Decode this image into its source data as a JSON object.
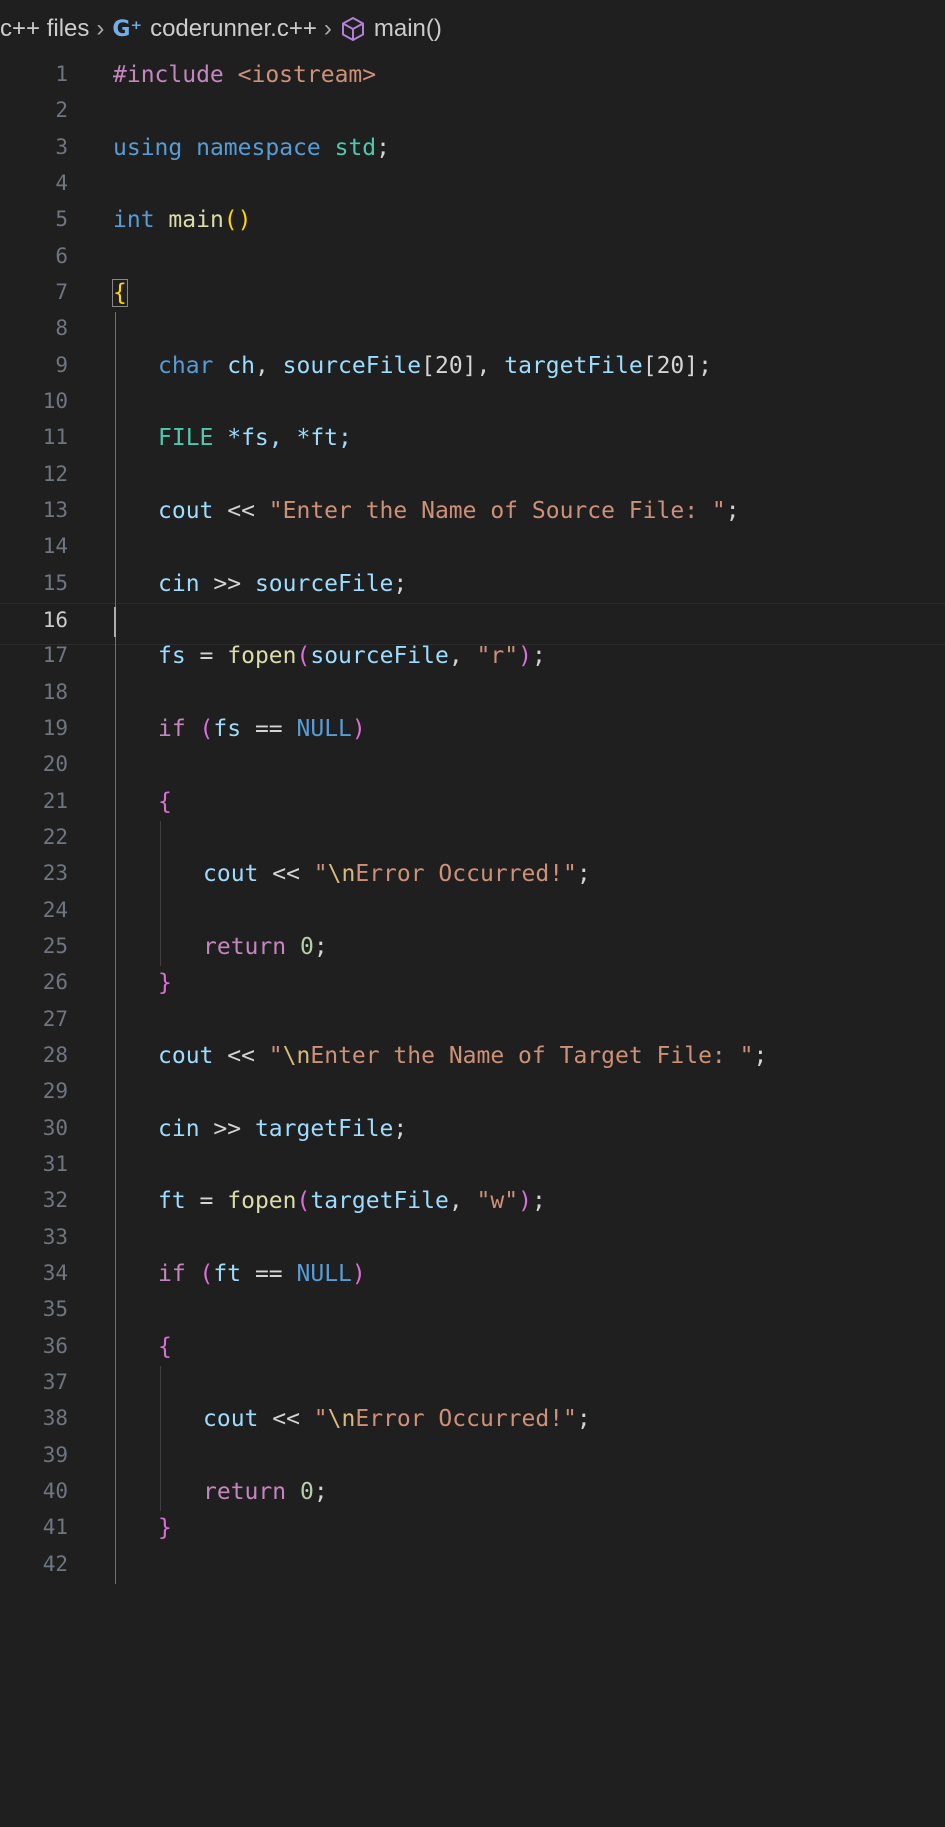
{
  "breadcrumb": {
    "folder": "c++ files",
    "sep": "›",
    "file": "coderunner.c++",
    "file_icon": "c++-file-icon",
    "symbol": "main()",
    "symbol_icon": "cube-method-icon"
  },
  "editor": {
    "active_line": 16,
    "line_numbers": [
      "1",
      "2",
      "3",
      "4",
      "5",
      "6",
      "7",
      "8",
      "9",
      "10",
      "11",
      "12",
      "13",
      "14",
      "15",
      "16",
      "17",
      "18",
      "19",
      "20",
      "21",
      "22",
      "23",
      "24",
      "25",
      "26",
      "27",
      "28",
      "29",
      "30",
      "31",
      "32",
      "33",
      "34",
      "35",
      "36",
      "37",
      "38",
      "39",
      "40",
      "41",
      "42"
    ],
    "code_text": {
      "l1_inc": "#include",
      "l1_path": "<iostream>",
      "l3_using": "using",
      "l3_namespace": "namespace",
      "l3_std": "std",
      "l3_semi": ";",
      "l5_int": "int",
      "l5_main": "main",
      "l5_parens": "()",
      "l7_brace": "{",
      "l9_char": "char",
      "l9_rest_a": "ch",
      "l9_comma1": ", ",
      "l9_src": "sourceFile",
      "l9_src_idx": "[20]",
      "l9_comma2": ", ",
      "l9_tgt": "targetFile",
      "l9_tgt_idx": "[20]",
      "l9_semi": ";",
      "l11_file": "FILE",
      "l11_rest": " *fs, *ft;",
      "l13_cout": "cout",
      "l13_op": " << ",
      "l13_str": "\"Enter the Name of Source File: \"",
      "l13_semi": ";",
      "l15_cin": "cin",
      "l15_op": " >> ",
      "l15_var": "sourceFile",
      "l15_semi": ";",
      "l17_fs": "fs",
      "l17_eq": " = ",
      "l17_fopen": "fopen",
      "l17_open": "(",
      "l17_arg": "sourceFile",
      "l17_comma": ", ",
      "l17_mode": "\"r\"",
      "l17_close": ")",
      "l17_semi": ";",
      "l19_if": "if",
      "l19_open": " (",
      "l19_fs": "fs",
      "l19_eq": " == ",
      "l19_null": "NULL",
      "l19_close": ")",
      "l21_brace": "{",
      "l23_cout": "cout",
      "l23_op": " << ",
      "l23_q1": "\"",
      "l23_esc": "\\n",
      "l23_str": "Error Occurred!\"",
      "l23_semi": ";",
      "l25_return": "return",
      "l25_zero": "0",
      "l25_semi": ";",
      "l26_brace": "}",
      "l28_cout": "cout",
      "l28_op": " << ",
      "l28_q1": "\"",
      "l28_esc": "\\n",
      "l28_str": "Enter the Name of Target File: \"",
      "l28_semi": ";",
      "l30_cin": "cin",
      "l30_op": " >> ",
      "l30_var": "targetFile",
      "l30_semi": ";",
      "l32_ft": "ft",
      "l32_eq": " = ",
      "l32_fopen": "fopen",
      "l32_open": "(",
      "l32_arg": "targetFile",
      "l32_comma": ", ",
      "l32_mode": "\"w\"",
      "l32_close": ")",
      "l32_semi": ";",
      "l34_if": "if",
      "l34_open": " (",
      "l34_ft": "ft",
      "l34_eq": " == ",
      "l34_null": "NULL",
      "l34_close": ")",
      "l36_brace": "{",
      "l38_cout": "cout",
      "l38_op": " << ",
      "l38_q1": "\"",
      "l38_esc": "\\n",
      "l38_str": "Error Occurred!\"",
      "l38_semi": ";",
      "l40_return": "return",
      "l40_zero": "0",
      "l40_semi": ";",
      "l41_brace": "}"
    }
  },
  "colors": {
    "background": "#1f1f1f",
    "keyword": "#569cd6",
    "control": "#c586c0",
    "function": "#dcdcaa",
    "variable": "#9cdcfe",
    "type": "#4ec9b0",
    "string": "#ce9178",
    "number": "#b5cea8",
    "bracket_level1": "#ffd700",
    "bracket_level2": "#da70d6",
    "bracket_level3": "#179fff"
  }
}
